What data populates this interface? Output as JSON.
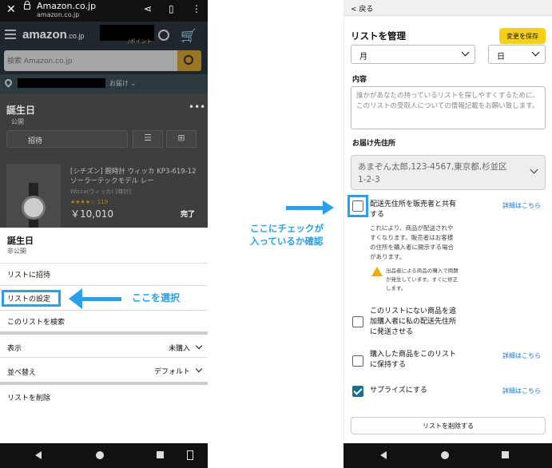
{
  "left": {
    "browser": {
      "domain": "Amazon.co.jp",
      "sub": "amazon.co.jp"
    },
    "header": {
      "logo": "amazon",
      "logo_suffix": ".co.jp",
      "points": "/ポイント"
    },
    "search": {
      "placeholder": "検索 Amazon.co.jp"
    },
    "deliver": {
      "label": "お届け"
    },
    "list": {
      "title": "誕生日",
      "visibility": "公開",
      "invite": "招待"
    },
    "product": {
      "name": "[シチズン] 腕時計 ウィッカ KP3-619-12 ソーラーテックモデル レー",
      "brand": "Wicca(ウィッカ) [時計]",
      "rating": "★★★★☆ 119",
      "price": "￥10,010",
      "done": "完了"
    },
    "sheet": {
      "title": "誕生日",
      "visibility": "非公開",
      "items": [
        "リストに招待",
        "リストの設定",
        "このリストを検索"
      ],
      "display_label": "表示",
      "display_value": "未購入",
      "sort_label": "並べ替え",
      "sort_value": "デフォルト",
      "delete": "リストを削除"
    }
  },
  "annotations": {
    "select_note": "ここを選択",
    "check_note_line1": "ここにチェックが",
    "check_note_line2": "入っているか確認"
  },
  "right": {
    "back": "< 戻る",
    "title": "リストを管理",
    "save": "変更を保存",
    "month": "月",
    "day": "日",
    "content_label": "内容",
    "content_placeholder": "誰かがあなたの持っているリストを探しやすくするために、このリストの受取人についての情報記載をお願い致します。",
    "address_label": "お届け先住所",
    "address_line1": "あまぞん太郎,123-4567,東京都,杉並区",
    "address_line2": "1-2-3",
    "options": [
      {
        "label_line1": "配送先住所を販売者と共有",
        "label_line2": "する",
        "checked": false,
        "link": "詳細はこちら"
      },
      {
        "label_line1": "このリストにない商品を追",
        "label_line2": "加購入者に私の配送先住所",
        "label_line3": "に発送させる",
        "checked": false
      },
      {
        "label_line1": "購入した商品をこのリスト",
        "label_line2": "に保持する",
        "checked": false,
        "link": "詳細はこちら"
      },
      {
        "label_line1": "サプライズにする",
        "checked": true,
        "link": "詳細はこちら"
      }
    ],
    "share_desc": [
      "これにより、商品が配送されや",
      "すくなります。販売者はお客様",
      "の住所を購入者に開示する場合",
      "があります。"
    ],
    "warning": [
      "出品者による商品の購入で問題",
      "が発生しています。すぐに修正",
      "します。"
    ],
    "delete": "リストを削除する"
  },
  "colors": {
    "accent": "#2aa0e8",
    "save_button": "#f5d014",
    "checkbox_checked": "#1c6f8a",
    "link": "#1a73c8"
  }
}
